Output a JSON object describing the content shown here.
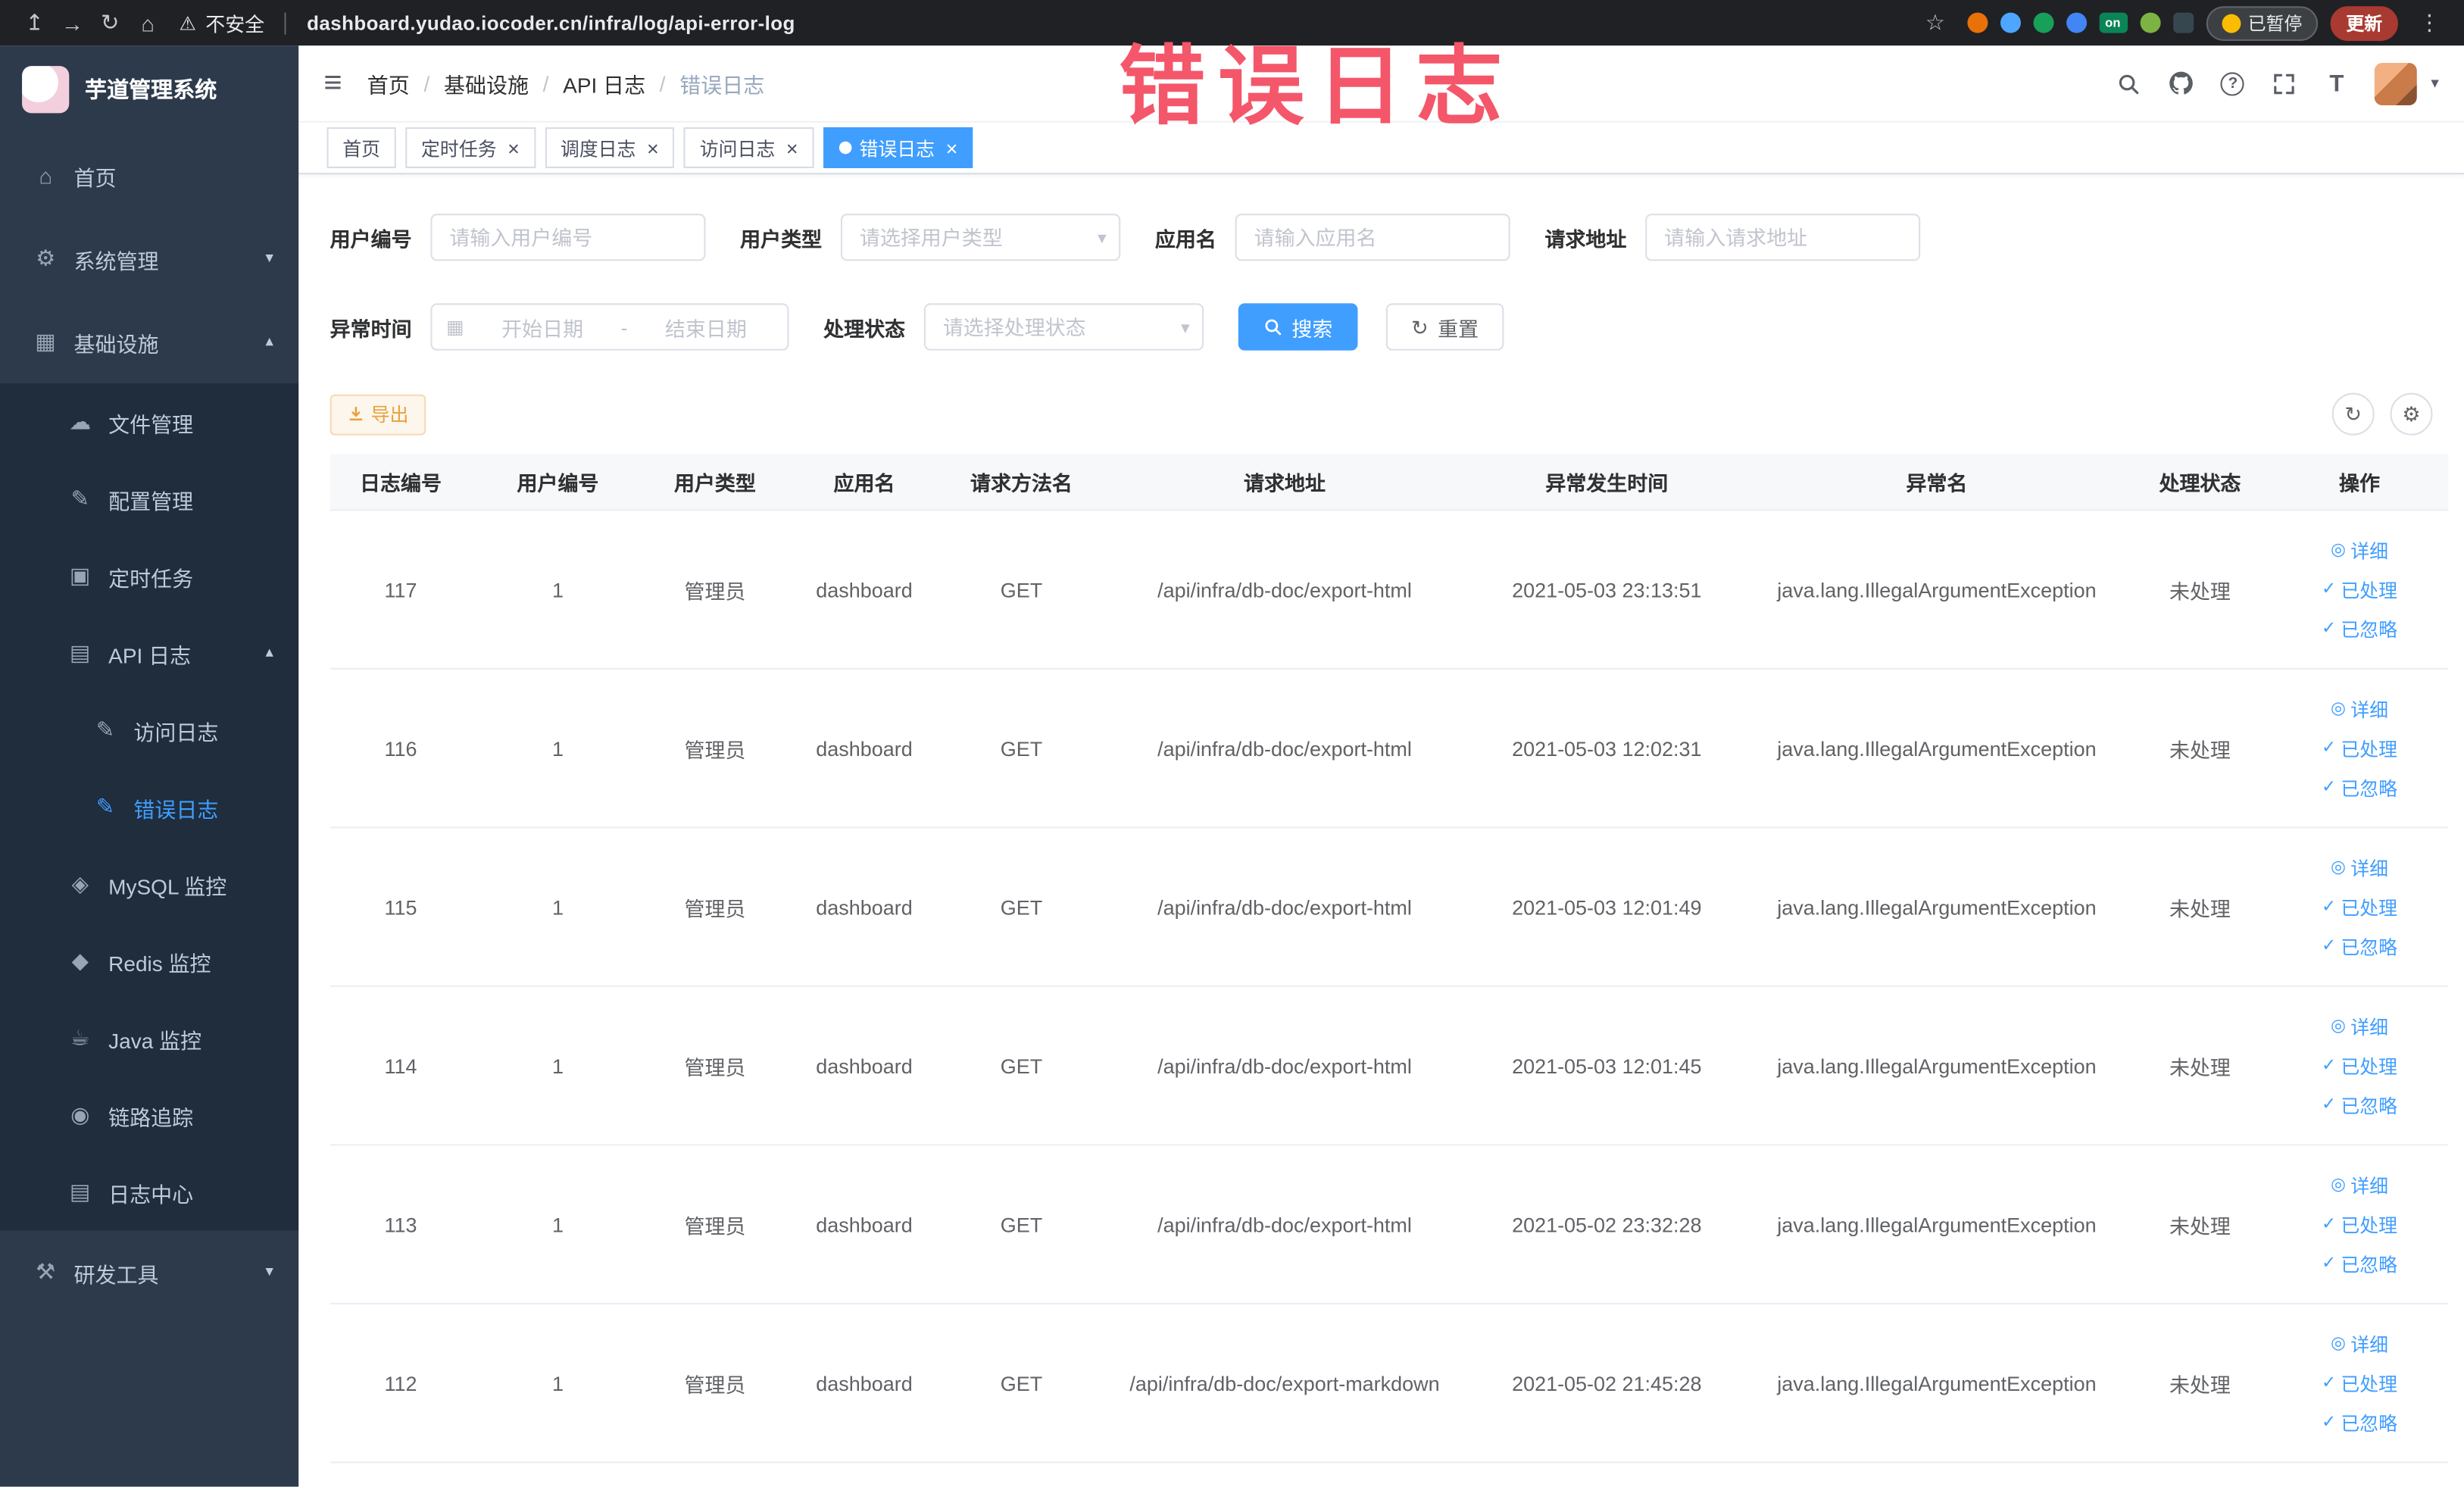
{
  "theme": {
    "accent": "#409eff",
    "overlay_color": "#f4566a"
  },
  "browser": {
    "security_label": "不安全",
    "url": "dashboard.yudao.iocoder.cn/infra/log/api-error-log",
    "paused_badge": "已暂停",
    "update_button": "更新"
  },
  "overlay": {
    "text": "错误日志"
  },
  "sidebar": {
    "logo_title": "芋道管理系统",
    "items": [
      {
        "id": "home",
        "label": "首页",
        "icon": "menu-home-icon",
        "level": 1
      },
      {
        "id": "system",
        "label": "系统管理",
        "icon": "menu-gear-icon",
        "level": 1,
        "chevron": "down"
      },
      {
        "id": "infra",
        "label": "基础设施",
        "icon": "menu-grid-icon",
        "level": 1,
        "chevron": "up"
      },
      {
        "id": "file",
        "label": "文件管理",
        "icon": "menu-file-icon",
        "level": 2
      },
      {
        "id": "config",
        "label": "配置管理",
        "icon": "menu-config-icon",
        "level": 2
      },
      {
        "id": "job",
        "label": "定时任务",
        "icon": "menu-task-icon",
        "level": 2
      },
      {
        "id": "api-log",
        "label": "API 日志",
        "icon": "menu-apilog-icon",
        "level": 2,
        "chevron": "up"
      },
      {
        "id": "access-log",
        "label": "访问日志",
        "icon": "menu-doc-icon",
        "level": 3
      },
      {
        "id": "error-log",
        "label": "错误日志",
        "icon": "menu-doc-icon",
        "level": 3,
        "active": true
      },
      {
        "id": "mysql",
        "label": "MySQL 监控",
        "icon": "menu-mysql-icon",
        "level": 2
      },
      {
        "id": "redis",
        "label": "Redis 监控",
        "icon": "menu-redis-icon",
        "level": 2
      },
      {
        "id": "java",
        "label": "Java 监控",
        "icon": "menu-java-icon",
        "level": 2
      },
      {
        "id": "trace",
        "label": "链路追踪",
        "icon": "menu-trace-icon",
        "level": 2
      },
      {
        "id": "log-center",
        "label": "日志中心",
        "icon": "menu-logcenter-icon",
        "level": 2
      },
      {
        "id": "dev-tools",
        "label": "研发工具",
        "icon": "menu-tools-icon",
        "level": 1,
        "chevron": "down"
      }
    ]
  },
  "header": {
    "breadcrumb": [
      "首页",
      "基础设施",
      "API 日志",
      "错误日志"
    ]
  },
  "tabs": [
    {
      "id": "home",
      "label": "首页",
      "closable": false,
      "active": false
    },
    {
      "id": "job",
      "label": "定时任务",
      "closable": true,
      "active": false
    },
    {
      "id": "job-log",
      "label": "调度日志",
      "closable": true,
      "active": false
    },
    {
      "id": "access-log",
      "label": "访问日志",
      "closable": true,
      "active": false
    },
    {
      "id": "error-log",
      "label": "错误日志",
      "closable": true,
      "active": true
    }
  ],
  "filters": {
    "user_id": {
      "label": "用户编号",
      "placeholder": "请输入用户编号"
    },
    "user_type": {
      "label": "用户类型",
      "placeholder": "请选择用户类型"
    },
    "app_name": {
      "label": "应用名",
      "placeholder": "请输入应用名"
    },
    "request_url": {
      "label": "请求地址",
      "placeholder": "请输入请求地址"
    },
    "exception_time": {
      "label": "异常时间",
      "start_placeholder": "开始日期",
      "separator": "-",
      "end_placeholder": "结束日期"
    },
    "process_status": {
      "label": "处理状态",
      "placeholder": "请选择处理状态"
    },
    "search_button": "搜索",
    "reset_button": "重置"
  },
  "toolbar": {
    "export_button": "导出"
  },
  "table": {
    "columns": [
      "日志编号",
      "用户编号",
      "用户类型",
      "应用名",
      "请求方法名",
      "请求地址",
      "异常发生时间",
      "异常名",
      "处理状态",
      "操作"
    ],
    "rows": [
      [
        "117",
        "1",
        "管理员",
        "dashboard",
        "GET",
        "/api/infra/db-doc/export-html",
        "2021-05-03 23:13:51",
        "java.lang.IllegalArgumentException",
        "未处理"
      ],
      [
        "116",
        "1",
        "管理员",
        "dashboard",
        "GET",
        "/api/infra/db-doc/export-html",
        "2021-05-03 12:02:31",
        "java.lang.IllegalArgumentException",
        "未处理"
      ],
      [
        "115",
        "1",
        "管理员",
        "dashboard",
        "GET",
        "/api/infra/db-doc/export-html",
        "2021-05-03 12:01:49",
        "java.lang.IllegalArgumentException",
        "未处理"
      ],
      [
        "114",
        "1",
        "管理员",
        "dashboard",
        "GET",
        "/api/infra/db-doc/export-html",
        "2021-05-03 12:01:45",
        "java.lang.IllegalArgumentException",
        "未处理"
      ],
      [
        "113",
        "1",
        "管理员",
        "dashboard",
        "GET",
        "/api/infra/db-doc/export-html",
        "2021-05-02 23:32:28",
        "java.lang.IllegalArgumentException",
        "未处理"
      ],
      [
        "112",
        "1",
        "管理员",
        "dashboard",
        "GET",
        "/api/infra/db-doc/export-markdown",
        "2021-05-02 21:45:28",
        "java.lang.IllegalArgumentException",
        "未处理"
      ]
    ],
    "row_actions": [
      {
        "id": "detail",
        "label": "详细",
        "icon": "eye-icon"
      },
      {
        "id": "processed",
        "label": "已处理",
        "icon": "check-icon"
      },
      {
        "id": "ignored",
        "label": "已忽略",
        "icon": "check-icon"
      }
    ]
  },
  "icons": {
    "share-icon": "↥",
    "forward-icon": "→",
    "reload-icon": "↻",
    "home-icon": "⌂",
    "warning-icon": "⚠",
    "star-icon": "☆",
    "kebab-icon": "⋮",
    "on-badge": "on",
    "hamburger-icon": "≡",
    "chevron-down-icon": "▾",
    "chevron-up-icon": "▴",
    "caret-down-icon": "▾",
    "help-icon": "?",
    "font-size-icon": "T",
    "menu-home-icon": "⌂",
    "menu-gear-icon": "⚙",
    "menu-grid-icon": "▦",
    "menu-file-icon": "☁",
    "menu-config-icon": "✎",
    "menu-task-icon": "▣",
    "menu-apilog-icon": "▤",
    "menu-doc-icon": "✎",
    "menu-mysql-icon": "◈",
    "menu-redis-icon": "◆",
    "menu-java-icon": "☕",
    "menu-trace-icon": "◉",
    "menu-logcenter-icon": "▤",
    "menu-tools-icon": "⚒",
    "eye-icon": "◎",
    "check-icon": "✓",
    "calendar-icon": "▦",
    "refresh-icon": "↻",
    "gear-icon": "⚙"
  }
}
